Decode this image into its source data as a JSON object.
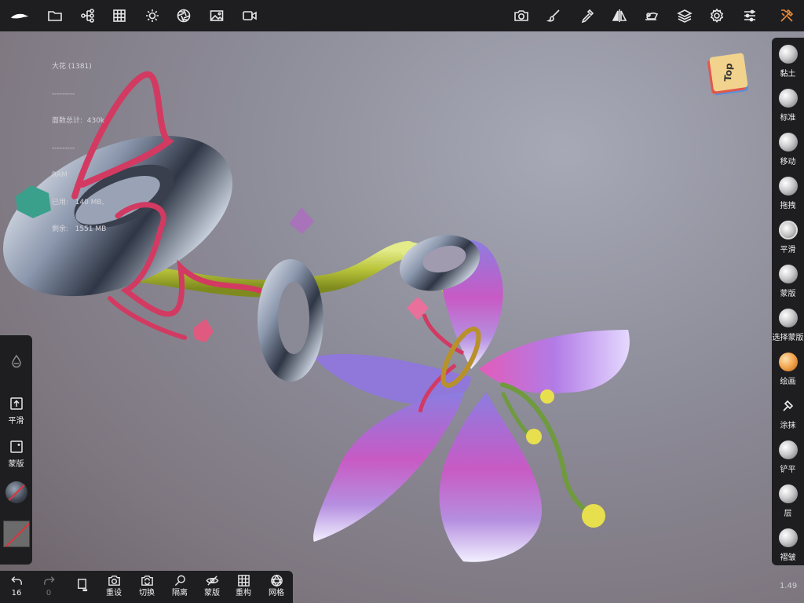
{
  "top_toolbar": {
    "left_icons": [
      "nomad-logo-icon",
      "folder-icon",
      "scene-tree-icon",
      "grid-icon",
      "sun-icon",
      "aperture-icon",
      "image-icon",
      "video-icon"
    ],
    "right_icons": [
      "camera-icon",
      "brush-icon",
      "dropper-icon",
      "symmetry-icon",
      "eraser-icon",
      "layers-icon",
      "gear-icon",
      "sliders-icon",
      "tools-icon"
    ],
    "tools_icon_color": "#e58a3c"
  },
  "stats": {
    "object": "大花 (1381)",
    "separator1": "---------",
    "faces": "面数总计:  430k",
    "separator2": "---------",
    "ram_label": "RAM",
    "used": "已用:   140 MB,",
    "free": "剩余:   1551 MB"
  },
  "view_cube": {
    "face": "Top"
  },
  "version": "1.49",
  "right_panel": {
    "tools": [
      {
        "label": "黏土",
        "icon": "clay-brush-icon"
      },
      {
        "label": "标准",
        "icon": "standard-brush-icon"
      },
      {
        "label": "移动",
        "icon": "move-brush-icon"
      },
      {
        "label": "拖拽",
        "icon": "drag-brush-icon"
      },
      {
        "label": "平滑",
        "icon": "smooth-brush-icon"
      },
      {
        "label": "蒙版",
        "icon": "mask-brush-icon"
      },
      {
        "label": "选择蒙版",
        "icon": "select-mask-icon"
      },
      {
        "label": "绘画",
        "icon": "paint-brush-icon"
      },
      {
        "label": "涂抹",
        "icon": "smudge-icon"
      },
      {
        "label": "铲平",
        "icon": "flatten-brush-icon"
      },
      {
        "label": "层",
        "icon": "layer-brush-icon"
      },
      {
        "label": "褶皱",
        "icon": "crease-brush-icon"
      }
    ],
    "active_color": "#f2a44c"
  },
  "left_panel": {
    "smooth_label": "平滑",
    "mask_label": "蒙版"
  },
  "bottom_toolbar": {
    "undo_count": "16",
    "redo_count": "0",
    "reset_label": "重设",
    "switch_label": "切换",
    "isolate_label": "隔离",
    "mask_label": "蒙版",
    "remesh_label": "重构",
    "mesh_label": "网格"
  }
}
